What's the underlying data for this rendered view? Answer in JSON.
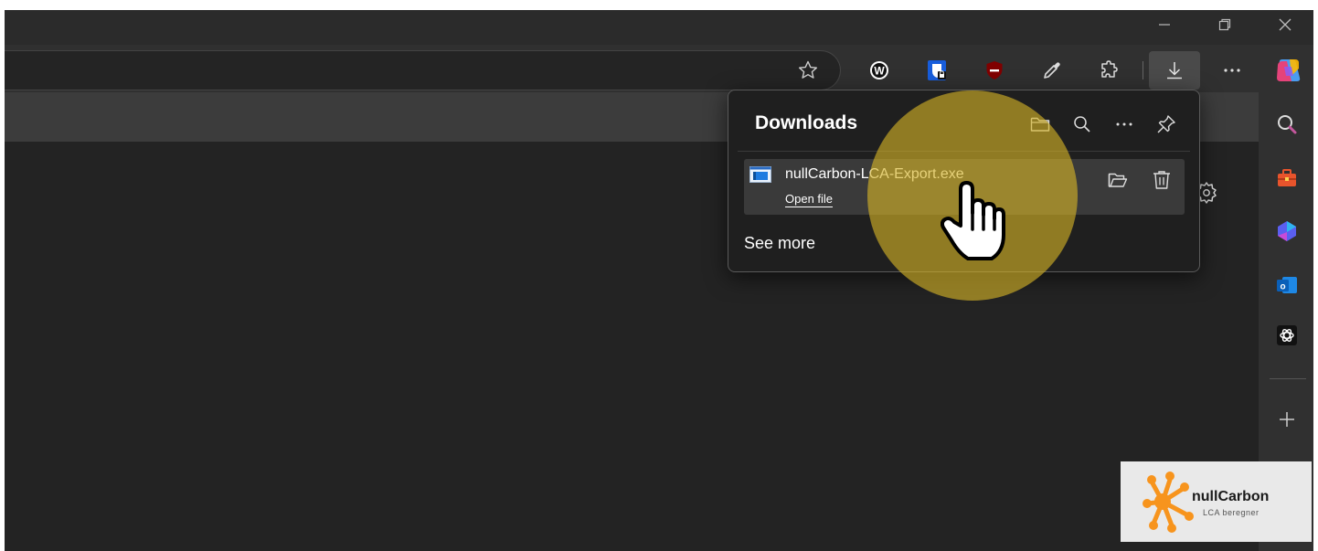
{
  "window": {
    "controls": [
      "minimize",
      "restore",
      "close"
    ]
  },
  "address_bar": {
    "value": "",
    "favorite_icon": "star-icon"
  },
  "toolbar": {
    "icons": [
      "w-extension-icon",
      "bitwarden-icon",
      "ublock-icon",
      "eyedropper-icon",
      "extensions-icon",
      "downloads-icon",
      "more-icon",
      "copilot-icon"
    ]
  },
  "downloads_panel": {
    "title": "Downloads",
    "header_actions": [
      "open-folder-icon",
      "search-icon",
      "more-icon",
      "pin-icon"
    ],
    "item": {
      "file_name": "nullCarbon-LCA-Export.exe",
      "action_label": "Open file"
    },
    "see_more": "See more"
  },
  "sidebar": {
    "icons": [
      "search-icon",
      "toolbox-icon",
      "copilot-icon",
      "outlook-icon",
      "chatgpt-icon",
      "add-icon"
    ]
  },
  "logo": {
    "name": "nullCarbon",
    "tagline": "LCA beregner"
  },
  "colors": {
    "highlight": "#d6b426",
    "logo_orange": "#f7941d",
    "panel_bg": "#1f1f1f"
  }
}
